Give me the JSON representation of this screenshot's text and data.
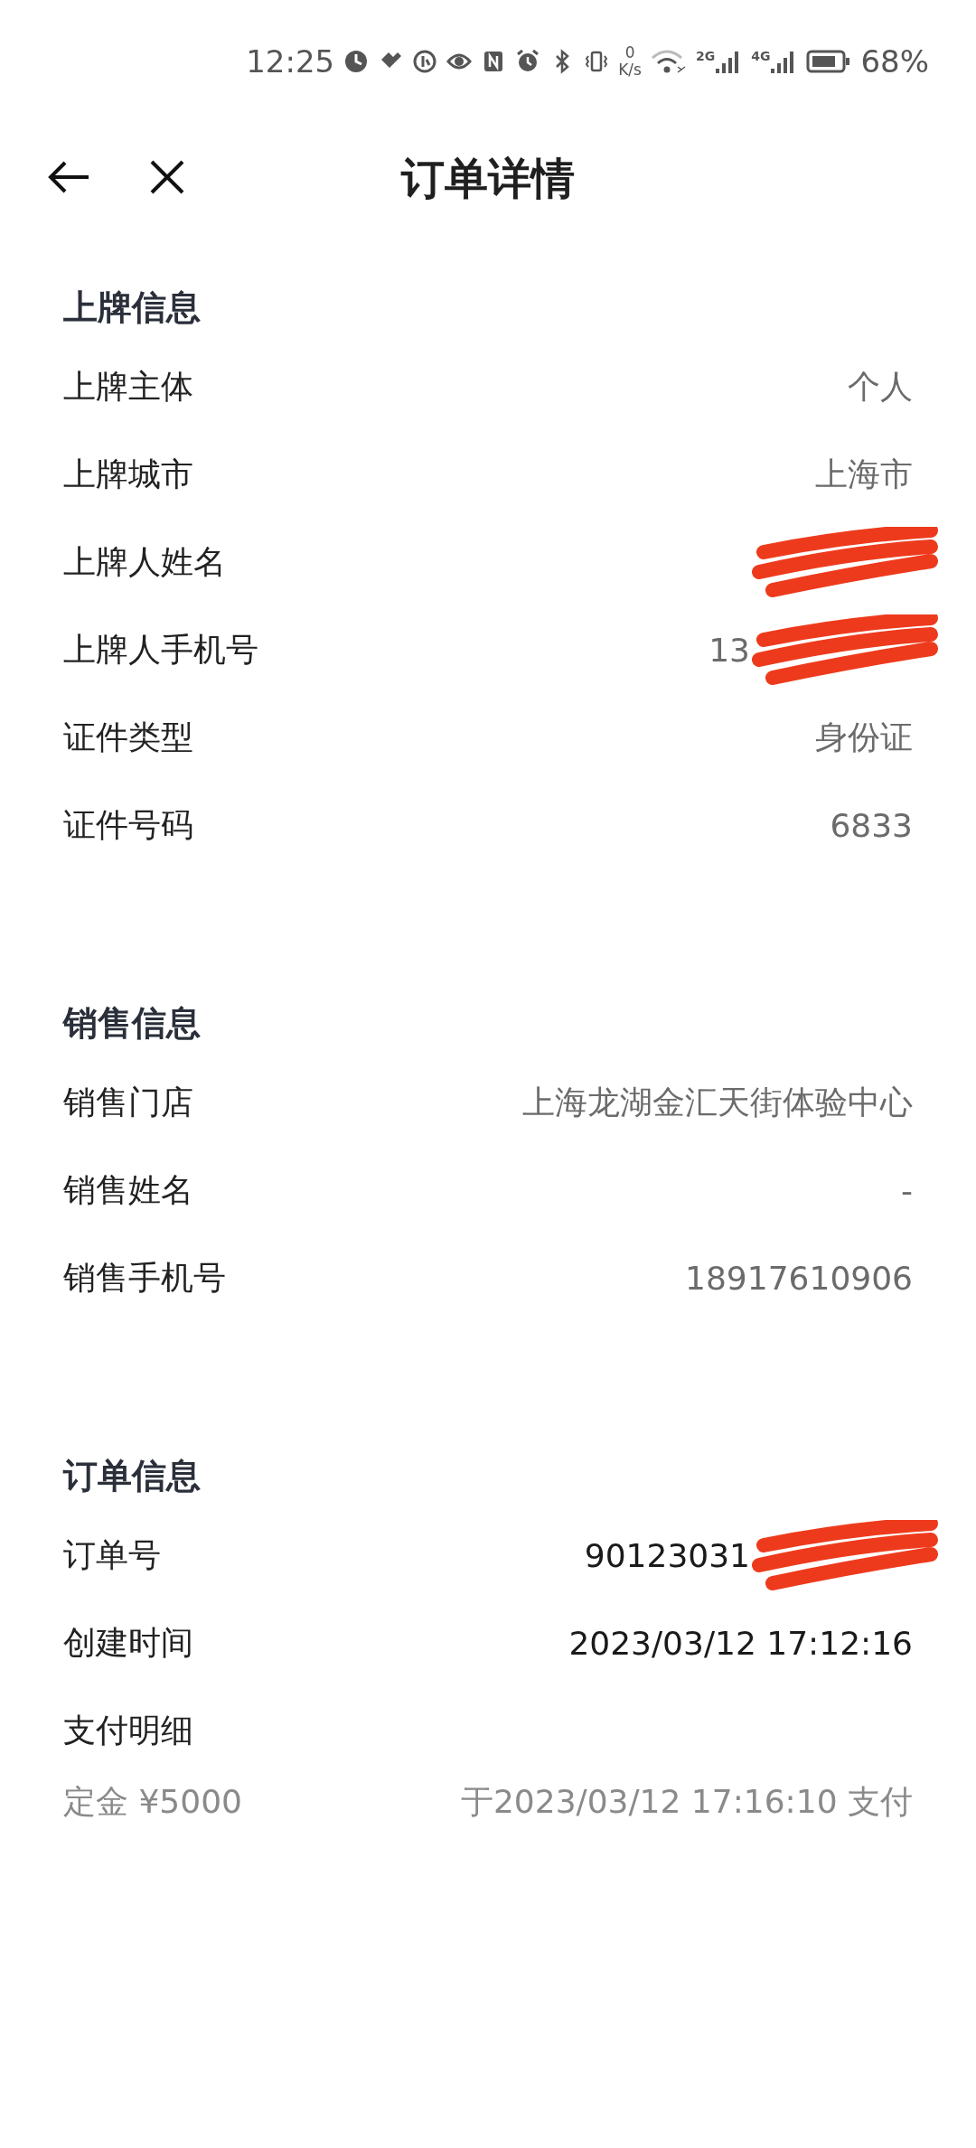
{
  "status_bar": {
    "time": "12:25",
    "net_speed_value": "0",
    "net_speed_unit": "K/s",
    "sim1": "2G",
    "sim2": "4G",
    "battery": "68%"
  },
  "header": {
    "title": "订单详情"
  },
  "sections": [
    {
      "title": "上牌信息",
      "rows": [
        {
          "kind": "row",
          "label": "上牌主体",
          "value": "个人",
          "muted": true,
          "redacted": false
        },
        {
          "kind": "row",
          "label": "上牌城市",
          "value": "上海市",
          "muted": true,
          "redacted": false
        },
        {
          "kind": "row",
          "label": "上牌人姓名",
          "redacted": true
        },
        {
          "kind": "row",
          "label": "上牌人手机号",
          "value": "13",
          "muted": true,
          "redacted": true
        },
        {
          "kind": "row",
          "label": "证件类型",
          "value": "身份证",
          "muted": true,
          "redacted": false
        },
        {
          "kind": "row",
          "label": "证件号码",
          "value": "6833",
          "muted": true,
          "redacted": false
        }
      ]
    },
    {
      "title": "销售信息",
      "rows": [
        {
          "kind": "row",
          "label": "销售门店",
          "value": "上海龙湖金汇天街体验中心",
          "muted": true,
          "redacted": false
        },
        {
          "kind": "row",
          "label": "销售姓名",
          "value": "-",
          "muted": true,
          "redacted": false
        },
        {
          "kind": "row",
          "label": "销售手机号",
          "value": "18917610906",
          "muted": true,
          "redacted": false
        }
      ]
    },
    {
      "title": "订单信息",
      "rows": [
        {
          "kind": "row",
          "label": "订单号",
          "value": "90123031",
          "muted": false,
          "redacted": true
        },
        {
          "kind": "row",
          "label": "创建时间",
          "value": "2023/03/12 17:12:16",
          "muted": false,
          "redacted": false
        },
        {
          "kind": "payment",
          "label": "支付明细",
          "amount": "定金 ¥5000",
          "detail": "于2023/03/12 17:16:10 支付"
        }
      ]
    }
  ]
}
